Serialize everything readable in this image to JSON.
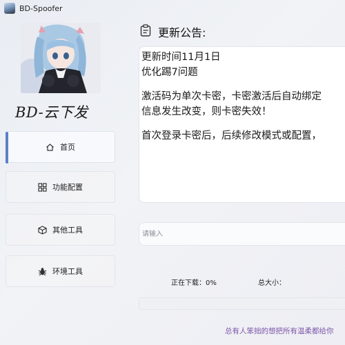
{
  "window": {
    "title": "BD-Spoofer"
  },
  "sidebar": {
    "brand": "BD-云下发",
    "items": [
      {
        "label": "首页",
        "icon": "home-icon",
        "active": true
      },
      {
        "label": "功能配置",
        "icon": "grid-icon",
        "active": false
      },
      {
        "label": "其他工具",
        "icon": "box-icon",
        "active": false
      },
      {
        "label": "环境工具",
        "icon": "bug-icon",
        "active": false
      }
    ]
  },
  "main": {
    "notice_title": "更新公告:",
    "notice_lines": [
      "更新时间11月1日",
      "优化踢7问题",
      "",
      "激活码为单次卡密，卡密激活后自动绑定",
      "信息发生改变，则卡密失效！",
      "",
      "首次登录卡密后，后续修改模式或配置，"
    ],
    "input_placeholder": "请输入",
    "download_label": "正在下载：0%",
    "total_size_label": "总大小：",
    "progress": 0,
    "footer_text": "总有人笨拙的想把所有温柔都给你"
  },
  "colors": {
    "accent": "#5b80c9",
    "footer": "#7d56a8"
  }
}
